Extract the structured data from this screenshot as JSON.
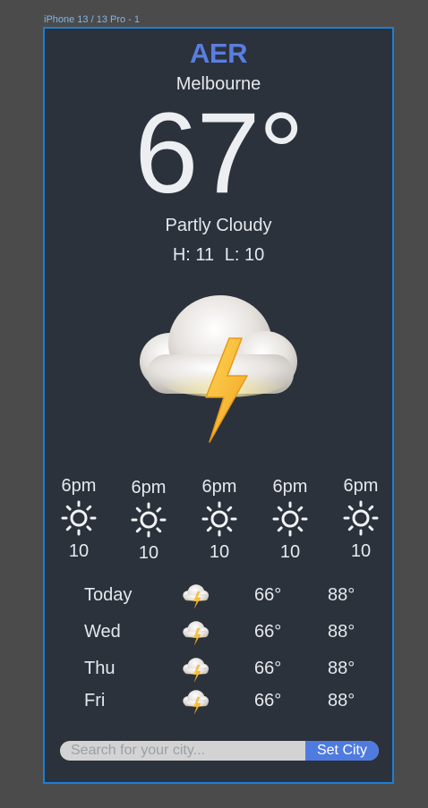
{
  "frame_label": "iPhone 13 / 13 Pro - 1",
  "app": {
    "brand": "AER",
    "city": "Melbourne",
    "temperature": "67°",
    "condition": "Partly Cloudy",
    "high": "H: 11",
    "low": "L: 10"
  },
  "hero_icon": "thunderstorm-cloud-icon",
  "hourly": [
    {
      "time": "6pm",
      "icon": "sun-icon",
      "value": "10"
    },
    {
      "time": "6pm",
      "icon": "sun-icon",
      "value": "10"
    },
    {
      "time": "6pm",
      "icon": "sun-icon",
      "value": "10"
    },
    {
      "time": "6pm",
      "icon": "sun-icon",
      "value": "10"
    },
    {
      "time": "6pm",
      "icon": "sun-icon",
      "value": "10"
    }
  ],
  "daily": [
    {
      "day": "Today",
      "icon": "thunderstorm-cloud-icon",
      "low": "66°",
      "high": "88°"
    },
    {
      "day": "Wed",
      "icon": "thunderstorm-cloud-icon",
      "low": "66°",
      "high": "88°"
    },
    {
      "day": "Thu",
      "icon": "thunderstorm-cloud-icon",
      "low": "66°",
      "high": "88°"
    },
    {
      "day": "Fri",
      "icon": "thunderstorm-cloud-icon",
      "low": "66°",
      "high": "88°"
    }
  ],
  "search": {
    "placeholder": "Search for your city...",
    "value": "",
    "button_label": "Set City"
  },
  "colors": {
    "background": "#2b323b",
    "brand": "#5a7de0",
    "button": "#4f7be0",
    "frame_border": "#1c7fd6"
  }
}
